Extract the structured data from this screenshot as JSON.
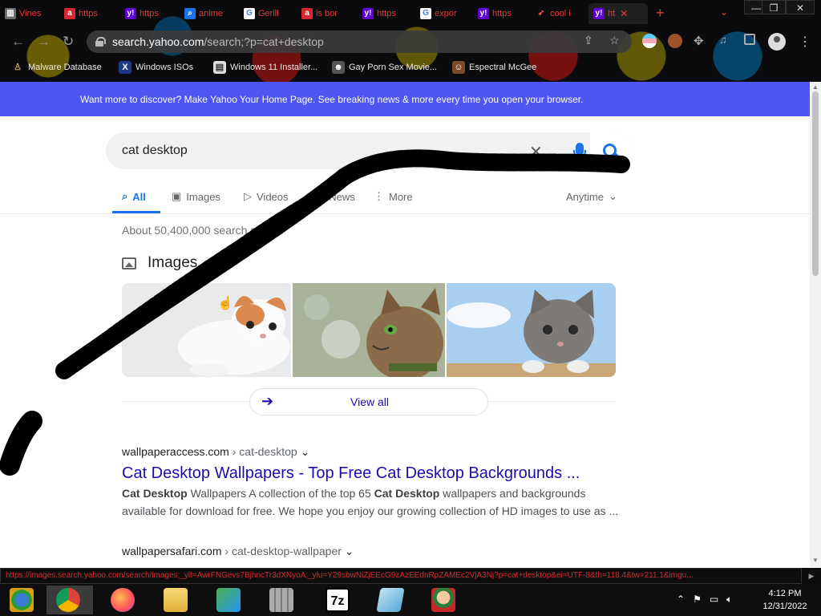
{
  "browser": {
    "tabs": [
      {
        "label": "Vines",
        "icon": "bank-icon"
      },
      {
        "label": "https",
        "icon": "ask-icon"
      },
      {
        "label": "https",
        "icon": "yahoo-icon"
      },
      {
        "label": "anime",
        "icon": "search-icon"
      },
      {
        "label": "Gerill",
        "icon": "google-icon"
      },
      {
        "label": "is bor",
        "icon": "ask-icon"
      },
      {
        "label": "https",
        "icon": "yahoo-icon"
      },
      {
        "label": "expor",
        "icon": "google-icon"
      },
      {
        "label": "https",
        "icon": "yahoo-icon"
      },
      {
        "label": "cool i",
        "icon": "rocket-icon"
      },
      {
        "label": "ht",
        "icon": "yahoo-icon",
        "active": true
      }
    ],
    "tab_close": "✕",
    "new_tab": "+",
    "url_host": "search.yahoo.com",
    "url_path": "/search;?p=cat+desktop",
    "bookmarks": [
      {
        "label": "Malware Database"
      },
      {
        "label": "Windows ISOs"
      },
      {
        "label": "Windows 11 Installer..."
      },
      {
        "label": "Gay Porn Sex Movie..."
      },
      {
        "label": "Espectral McGee"
      }
    ],
    "status_url": "https://images.search.yahoo.com/search/images;_ylt=AwrFNGevs7BjhncTr3dXNyoA;_ylu=Y29sbwNiZjEEcG9zAzEEdnRpZAMEc2VjA3Nj?p=cat+desktop&ei=UTF-8&th=118.4&tw=211.1&imgu..."
  },
  "page": {
    "banner": "Want more to discover? Make Yahoo Your Home Page. See breaking news & more every time you open your browser.",
    "search_query": "cat desktop",
    "vertical_tabs": {
      "all": "All",
      "images": "Images",
      "videos": "Videos",
      "news": "News",
      "more": "More",
      "anytime": "Anytime"
    },
    "result_count": "About 50,400,000 search results",
    "images_heading": "Images",
    "view_all": "View all",
    "results": [
      {
        "cite_host": "wallpaperaccess.com",
        "cite_path": " › cat-desktop",
        "title": "Cat Desktop Wallpapers - Top Free Cat Desktop Backgrounds ...",
        "snippet_html_parts": [
          "Cat Desktop",
          " Wallpapers A collection of the top 65 ",
          "Cat Desktop",
          " wallpapers and backgrounds available for download for free. We hope you enjoy our growing collection of HD images to use as ..."
        ]
      },
      {
        "cite_host": "wallpapersafari.com",
        "cite_path": " › cat-desktop-wallpaper"
      }
    ]
  },
  "taskbar": {
    "clock_time": "4:12 PM",
    "clock_date": "12/31/2022",
    "apps": [
      "windows-start-icon",
      "chrome-icon",
      "firefox-icon",
      "file-explorer-icon",
      "network-people-icon",
      "wall-app-icon",
      "7zip-icon",
      "notepad-icon",
      "game-character-icon"
    ]
  },
  "colors": {
    "banner": "#4e55f0",
    "link": "#1a0dab",
    "accent": "#1a73e8",
    "tab_text": "#e23b3b"
  }
}
